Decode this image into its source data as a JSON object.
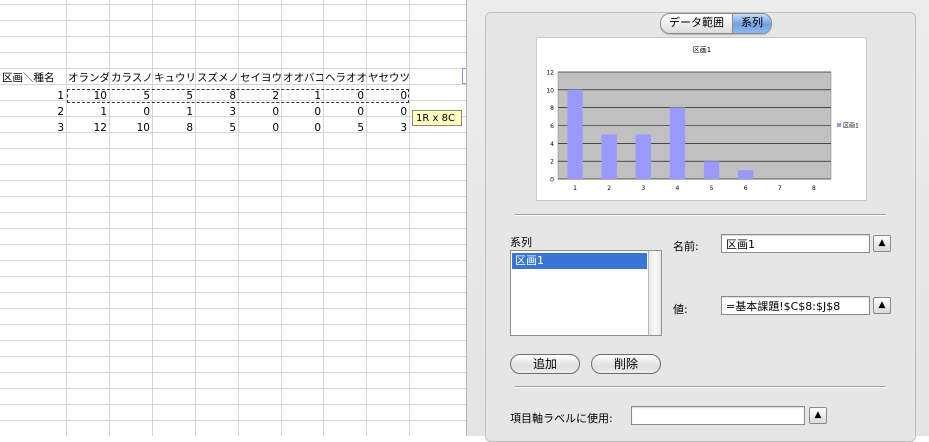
{
  "sheet": {
    "header": [
      "区画＼種名",
      "オランダ",
      "カラスノ",
      "キュウリ",
      "スズメノ",
      "セイヨウ",
      "オオバコ",
      "ヘラオオ",
      "ヤセウツボ"
    ],
    "rows": [
      [
        "1",
        "10",
        "5",
        "5",
        "8",
        "2",
        "1",
        "0",
        "0"
      ],
      [
        "2",
        "1",
        "0",
        "1",
        "3",
        "0",
        "0",
        "0",
        "0"
      ],
      [
        "3",
        "12",
        "10",
        "8",
        "5",
        "0",
        "0",
        "5",
        "3"
      ]
    ],
    "tooltip": "1R x 8C"
  },
  "dialog": {
    "tabs": [
      {
        "label": "データ範囲",
        "active": false
      },
      {
        "label": "系列",
        "active": true
      }
    ],
    "series_list_label": "系列",
    "series_items": [
      "区画1"
    ],
    "name_label": "名前:",
    "name_value": "区画1",
    "value_label": "値:",
    "value_value": "=基本課題!$C$8:$J$8",
    "add_button": "追加",
    "delete_button": "削除",
    "category_label": "項目軸ラベルに使用:",
    "category_value": "",
    "collapse_glyph": "▲"
  },
  "chart_data": {
    "type": "bar",
    "title": "区画1",
    "categories": [
      "1",
      "2",
      "3",
      "4",
      "5",
      "6",
      "7",
      "8"
    ],
    "series": [
      {
        "name": "区画1",
        "values": [
          10,
          5,
          5,
          8,
          2,
          1,
          0,
          0
        ]
      }
    ],
    "ylim": [
      0,
      12
    ],
    "yticks": [
      "0",
      "2",
      "4",
      "6",
      "8",
      "10",
      "12"
    ],
    "grid": true,
    "legend": "right",
    "colors": {
      "bar": "#9999ff",
      "plot_bg": "#c0c0c0"
    }
  }
}
